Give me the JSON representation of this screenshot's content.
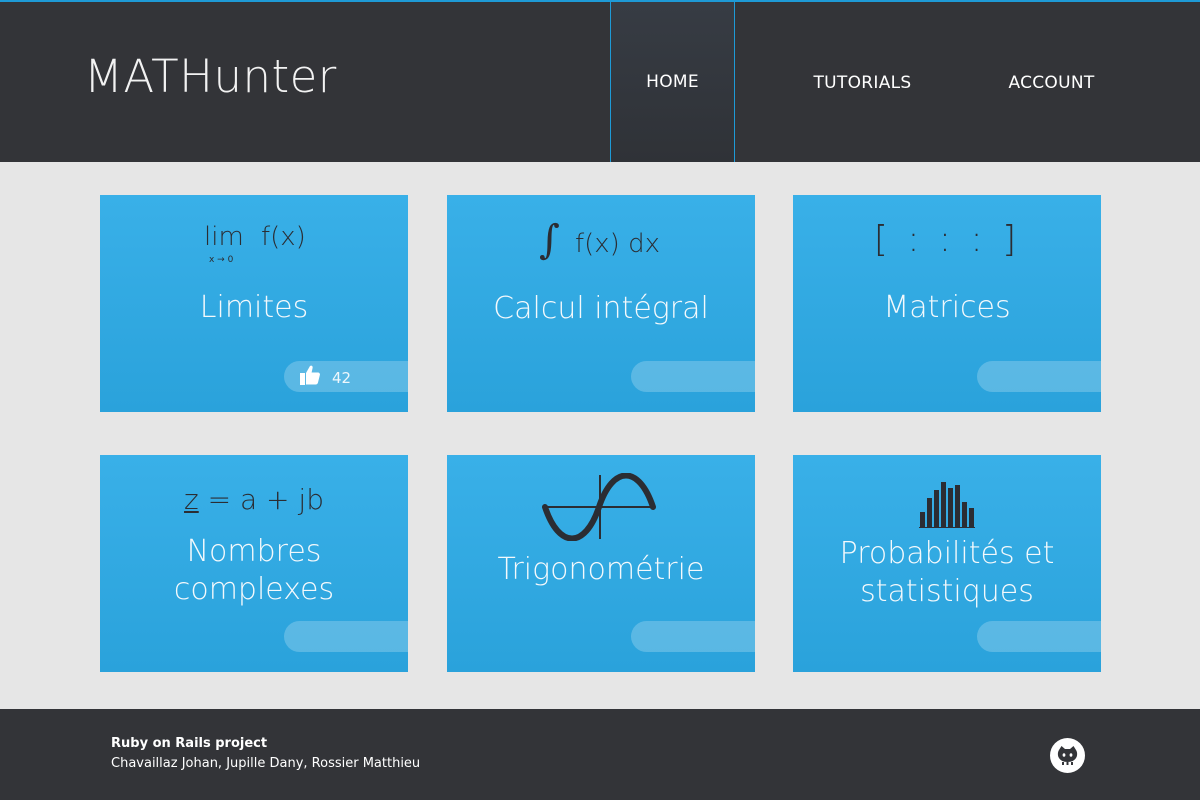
{
  "app": {
    "logo": "MATHunter"
  },
  "nav": {
    "items": [
      {
        "label": "HOME",
        "active": true
      },
      {
        "label": "TUTORIALS",
        "active": false
      },
      {
        "label": "ACCOUNT",
        "active": false
      }
    ]
  },
  "cards": [
    {
      "title": "Limites",
      "icon": "limit-formula",
      "formula": {
        "lim": "lim",
        "sub": "x → 0",
        "fx": "f(x)"
      },
      "likes": "42"
    },
    {
      "title": "Calcul intégral",
      "icon": "integral-formula",
      "formula": {
        "integral": "∫",
        "expr": "f(x) dx"
      }
    },
    {
      "title": "Matrices",
      "icon": "matrix-icon",
      "formula": {
        "expr": "[ : : : ]"
      }
    },
    {
      "title_line1": "Nombres",
      "title_line2": "complexes",
      "icon": "complex-formula",
      "formula": {
        "z": "z",
        "expr": " = a + jb"
      }
    },
    {
      "title": "Trigonométrie",
      "icon": "sine-wave-icon"
    },
    {
      "title_line1": "Probabilités et",
      "title_line2": "statistiques",
      "icon": "histogram-icon"
    }
  ],
  "footer": {
    "title": "Ruby on Rails project",
    "authors": "Chavaillaz Johan, Jupille Dany, Rossier Matthieu",
    "github_icon": "github-icon"
  },
  "colors": {
    "accent": "#1e9ad6",
    "header_bg": "#333438",
    "card_top": "#39b0e8",
    "card_bottom": "#2aa2db",
    "page_bg": "#e6e6e6"
  }
}
